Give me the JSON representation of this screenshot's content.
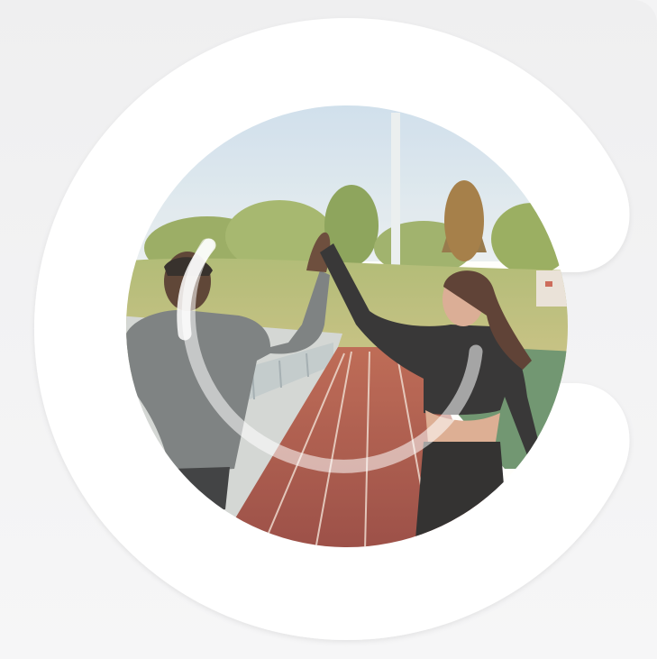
{
  "graphic": {
    "subject": "hero-photo",
    "colors": {
      "background": "#f2f2f3",
      "brand_shape": "#ffffff",
      "sky": "#cfe0ef",
      "trees": "#8aa35a",
      "track": "#a24a3e",
      "lane_line": "#e9d8cf",
      "railing": "#c4cdd2",
      "arc_overlay": "#ffffff"
    }
  }
}
